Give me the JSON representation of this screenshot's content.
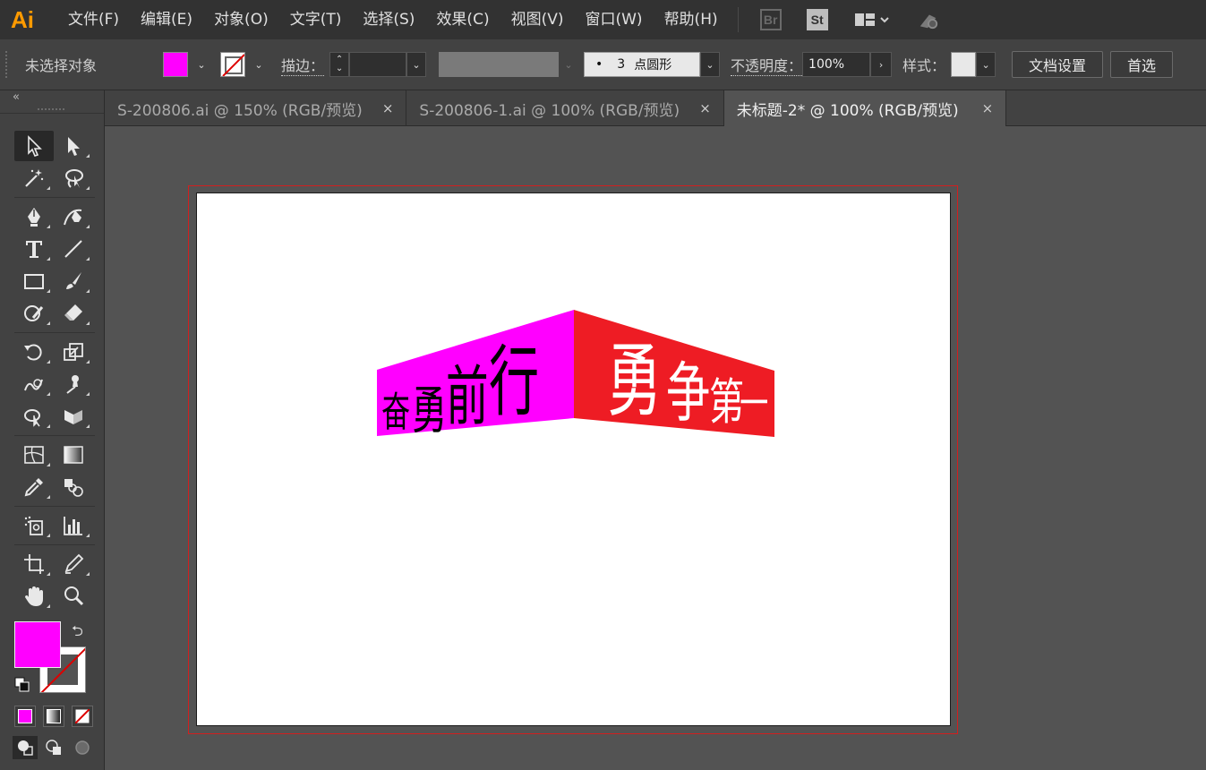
{
  "app": {
    "logo": "Ai"
  },
  "menu": [
    "文件(F)",
    "编辑(E)",
    "对象(O)",
    "文字(T)",
    "选择(S)",
    "效果(C)",
    "视图(V)",
    "窗口(W)",
    "帮助(H)"
  ],
  "menubar_icons": {
    "bridge": "Br",
    "stock": "St"
  },
  "control": {
    "selection_status": "未选择对象",
    "stroke_label": "描边：",
    "brush_dot": "•",
    "brush_size": "3",
    "brush_name": "点圆形",
    "opacity_label": "不透明度：",
    "opacity_value": "100%",
    "style_label": "样式：",
    "doc_setup": "文档设置",
    "preferences": "首选"
  },
  "tabs": [
    {
      "label": "S-200806.ai @ 150% (RGB/预览)",
      "close": "×",
      "active": false
    },
    {
      "label": "S-200806-1.ai @ 100% (RGB/预览)",
      "close": "×",
      "active": false
    },
    {
      "label": "未标题-2* @ 100% (RGB/预览)",
      "close": "×",
      "active": true
    }
  ],
  "colors": {
    "fill": "#ff00ff",
    "magenta_panel": "#ff00ff",
    "red_panel": "#ee1c24",
    "accent": "#ff9a00"
  },
  "artwork": {
    "left_text": [
      "奋",
      "勇",
      "前",
      "行"
    ],
    "right_text": [
      "勇",
      "争",
      "第",
      "一"
    ]
  },
  "icons": [
    "selection-icon",
    "direct-selection-icon",
    "magic-wand-icon",
    "lasso-icon",
    "pen-icon",
    "curvature-icon",
    "type-icon",
    "line-icon",
    "rectangle-icon",
    "paintbrush-icon",
    "shaper-icon",
    "eraser-icon",
    "rotate-icon",
    "scale-icon",
    "warp-icon",
    "puppet-warp-icon",
    "shape-builder-icon",
    "perspective-icon",
    "mesh-icon",
    "gradient-icon",
    "eyedropper-icon",
    "blend-icon",
    "symbol-sprayer-icon",
    "column-graph-icon",
    "artboard-icon",
    "slice-icon",
    "hand-icon",
    "zoom-icon"
  ]
}
